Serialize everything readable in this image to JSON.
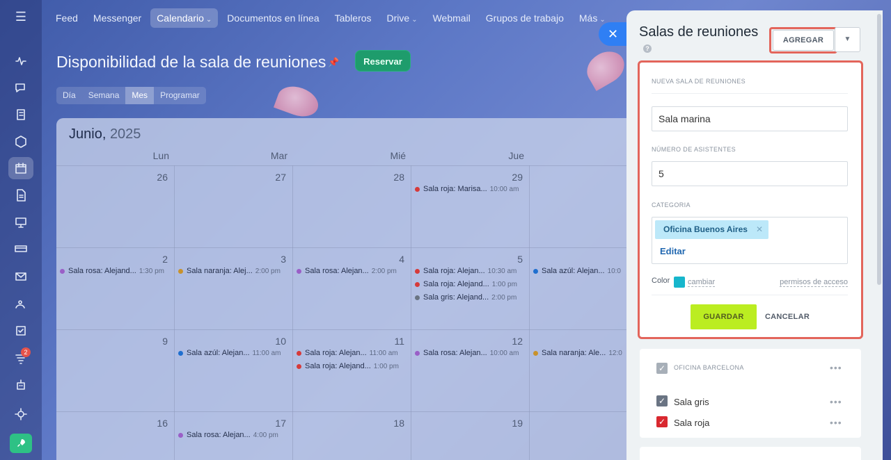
{
  "nav": {
    "items": [
      {
        "label": "Feed",
        "caret": false
      },
      {
        "label": "Messenger",
        "caret": false
      },
      {
        "label": "Calendario",
        "caret": true,
        "active": true
      },
      {
        "label": "Documentos en línea",
        "caret": false
      },
      {
        "label": "Tableros",
        "caret": false
      },
      {
        "label": "Drive",
        "caret": true
      },
      {
        "label": "Webmail",
        "caret": false
      },
      {
        "label": "Grupos de trabajo",
        "caret": false
      },
      {
        "label": "Más",
        "caret": true
      }
    ]
  },
  "rail": {
    "icons": [
      "pulse-icon",
      "chat-icon",
      "tasks-icon",
      "sites-icon",
      "calendar-icon",
      "docs-icon",
      "presentation-icon",
      "crm-icon",
      "mail-icon",
      "team-icon",
      "checklist-icon",
      "automation-icon",
      "robot-icon",
      "settings-icon"
    ],
    "badge": "2"
  },
  "page": {
    "title": "Disponibilidad de la sala de reuniones",
    "reserve_label": "Reservar",
    "view_tabs": [
      "Día",
      "Semana",
      "Mes",
      "Programar"
    ],
    "active_view": "Mes"
  },
  "calendar": {
    "month": "Junio,",
    "year": "2025",
    "weekdays": [
      "Lun",
      "Mar",
      "Mié",
      "Jue"
    ],
    "weeks": [
      {
        "days": [
          {
            "num": "26",
            "events": []
          },
          {
            "num": "27",
            "events": []
          },
          {
            "num": "28",
            "events": []
          },
          {
            "num": "29",
            "events": [
              {
                "name": "Sala roja: Marisa...",
                "time": "10:00 am",
                "color": "#d63a3a"
              }
            ]
          },
          {
            "num": "",
            "events": []
          }
        ]
      },
      {
        "days": [
          {
            "num": "2",
            "events": [
              {
                "name": "Sala rosa: Alejand...",
                "time": "1:30 pm",
                "color": "#9a5fc7"
              }
            ]
          },
          {
            "num": "3",
            "events": [
              {
                "name": "Sala naranja: Alej...",
                "time": "2:00 pm",
                "color": "#c8922c"
              }
            ]
          },
          {
            "num": "4",
            "events": [
              {
                "name": "Sala rosa: Alejan...",
                "time": "2:00 pm",
                "color": "#9a5fc7"
              }
            ]
          },
          {
            "num": "5",
            "events": [
              {
                "name": "Sala roja: Alejan...",
                "time": "10:30 am",
                "color": "#d63a3a"
              },
              {
                "name": "Sala roja: Alejand...",
                "time": "1:00 pm",
                "color": "#d63a3a"
              },
              {
                "name": "Sala gris: Alejand...",
                "time": "2:00 pm",
                "color": "#6a7483"
              }
            ]
          },
          {
            "num": "",
            "events": [
              {
                "name": "Sala azúl: Alejan...",
                "time": "10:0",
                "color": "#1f6fcf"
              }
            ]
          }
        ]
      },
      {
        "days": [
          {
            "num": "9",
            "events": []
          },
          {
            "num": "10",
            "events": [
              {
                "name": "Sala azúl: Alejan...",
                "time": "11:00 am",
                "color": "#1f6fcf"
              }
            ]
          },
          {
            "num": "11",
            "events": [
              {
                "name": "Sala roja: Alejan...",
                "time": "11:00 am",
                "color": "#d63a3a"
              },
              {
                "name": "Sala roja: Alejand...",
                "time": "1:00 pm",
                "color": "#d63a3a"
              }
            ]
          },
          {
            "num": "12",
            "events": [
              {
                "name": "Sala rosa: Alejan...",
                "time": "10:00 am",
                "color": "#9a5fc7"
              }
            ]
          },
          {
            "num": "",
            "events": [
              {
                "name": "Sala naranja: Ale...",
                "time": "12:0",
                "color": "#c8922c"
              }
            ]
          }
        ]
      },
      {
        "days": [
          {
            "num": "16",
            "events": []
          },
          {
            "num": "17",
            "events": [
              {
                "name": "Sala rosa: Alejan...",
                "time": "4:00 pm",
                "color": "#9a5fc7"
              }
            ]
          },
          {
            "num": "18",
            "events": []
          },
          {
            "num": "19",
            "events": []
          },
          {
            "num": "",
            "events": []
          }
        ]
      }
    ]
  },
  "panel": {
    "title": "Salas de reuniones",
    "add_label": "AGREGAR",
    "form": {
      "section_label": "NUEVA SALA DE REUNIONES",
      "name_value": "Sala marina",
      "attendees_label": "NÚMERO DE ASISTENTES",
      "attendees_value": "5",
      "category_label": "CATEGORIA",
      "category_tag": "Oficina Buenos Aires",
      "edit_label": "Editar",
      "color_label": "Color",
      "color_value": "#17b6cc",
      "change_label": "cambiar",
      "permissions_label": "permisos de acceso",
      "save_label": "GUARDAR",
      "cancel_label": "CANCELAR"
    },
    "list": {
      "section_label": "OFICINA BARCELONA",
      "rooms": [
        {
          "label": "Sala gris",
          "color": "#6a7483"
        },
        {
          "label": "Sala roja",
          "color": "#d9282f"
        }
      ]
    }
  }
}
